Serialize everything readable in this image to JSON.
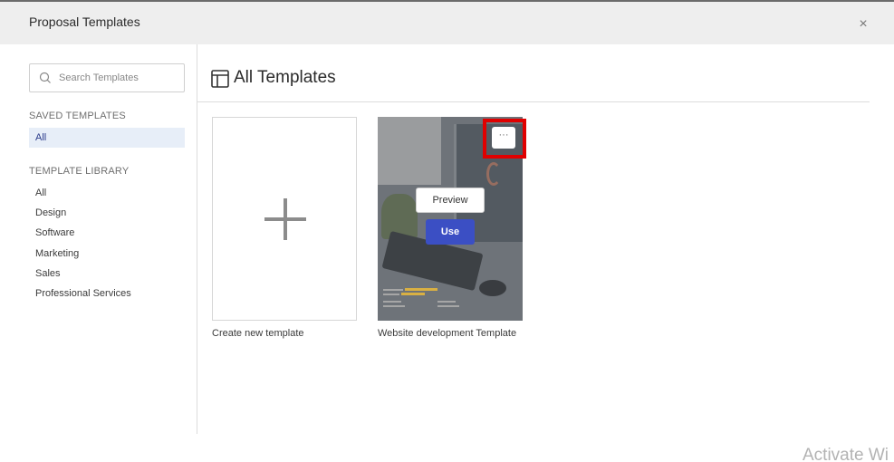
{
  "dialog": {
    "title": "Proposal Templates",
    "close_label": "×"
  },
  "sidebar": {
    "search": {
      "placeholder": "Search Templates",
      "value": ""
    },
    "saved_section_label": "SAVED TEMPLATES",
    "saved_items": [
      {
        "label": "All",
        "active": true
      }
    ],
    "library_section_label": "TEMPLATE LIBRARY",
    "library_items": [
      {
        "label": "All"
      },
      {
        "label": "Design"
      },
      {
        "label": "Software"
      },
      {
        "label": "Marketing"
      },
      {
        "label": "Sales"
      },
      {
        "label": "Professional Services"
      }
    ]
  },
  "main": {
    "title": "All Templates",
    "cards": [
      {
        "label": "Create new template",
        "icon": "plus-icon"
      },
      {
        "label": "Website development Template",
        "preview_label": "Preview",
        "use_label": "Use",
        "more_label": "···"
      }
    ]
  },
  "watermark": "Activate Wi",
  "colors": {
    "accent": "#3b4fc4",
    "highlight_box": "#e00000",
    "active_nav_bg": "#e7eef8",
    "header_bg": "#eeeeee"
  }
}
